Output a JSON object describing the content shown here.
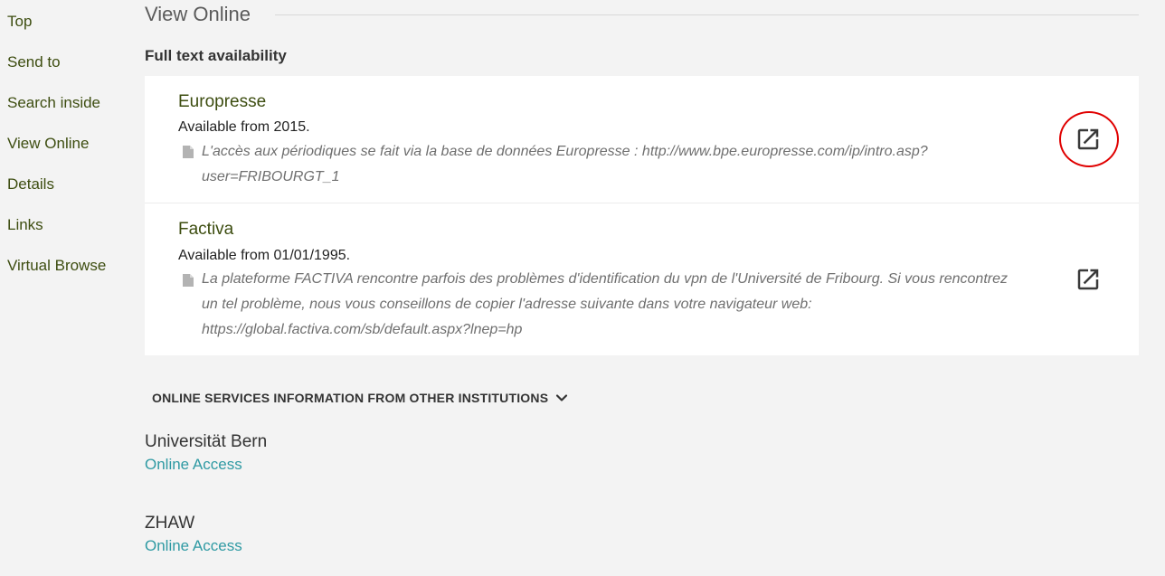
{
  "nav": {
    "items": [
      {
        "label": "Top"
      },
      {
        "label": "Send to"
      },
      {
        "label": "Search inside"
      },
      {
        "label": "View Online"
      },
      {
        "label": "Details"
      },
      {
        "label": "Links"
      },
      {
        "label": "Virtual Browse"
      }
    ]
  },
  "view_online": {
    "title": "View Online",
    "full_text_label": "Full text availability",
    "services": [
      {
        "name": "Europresse",
        "availability": "Available from 2015.",
        "note": "L'accès aux périodiques se fait via la base de données Europresse : http://www.bpe.europresse.com/ip/intro.asp?user=FRIBOURGT_1",
        "note_lines": [
          "L'accès aux périodiques se fait via la base de données Europresse : http://www.bpe.europresse.com/ip/intro.asp?",
          "user=FRIBOURGT_1"
        ],
        "link_icon": "open-in-new-icon",
        "highlighted": true
      },
      {
        "name": "Factiva",
        "availability": "Available from 01/01/1995.",
        "note": "La plateforme FACTIVA rencontre parfois des problèmes d'identification du vpn de l'Université de Fribourg. Si vous rencontrez un tel problème, nous vous conseillons de copier l'adresse suivante dans votre navigateur web: https://global.factiva.com/sb/default.aspx?lnep=hp",
        "note_lines": [
          "La plateforme FACTIVA rencontre parfois des problèmes d'identification du vpn de l'Université de Fribourg. Si vous rencontrez",
          "un tel problème, nous vous conseillons de copier l'adresse suivante dans votre navigateur web:",
          "https://global.factiva.com/sb/default.aspx?lnep=hp"
        ],
        "link_icon": "open-in-new-icon",
        "highlighted": false
      }
    ]
  },
  "other_institutions": {
    "toggle_label": "ONLINE SERVICES INFORMATION FROM OTHER INSTITUTIONS",
    "toggle_icon": "chevron-down-icon",
    "institutions": [
      {
        "name": "Universität Bern",
        "link_label": "Online Access"
      },
      {
        "name": "ZHAW",
        "link_label": "Online Access"
      }
    ]
  },
  "colors": {
    "background": "#f3f3f3",
    "nav_link": "#3d4d10",
    "access_link": "#2f9aa3",
    "highlight_ring": "#e00000"
  }
}
